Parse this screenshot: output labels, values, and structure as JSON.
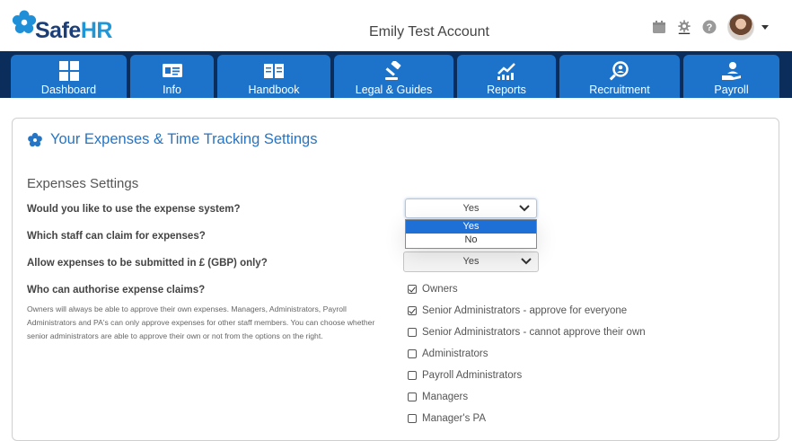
{
  "brand": {
    "name_part1": "Safe",
    "name_part2": "HR",
    "color_dark": "#1c3f78",
    "color_light": "#2196d6"
  },
  "header": {
    "account_name": "Emily Test Account",
    "icons": [
      "calendar-icon",
      "settings-gear-icon",
      "help-icon",
      "user-avatar",
      "account-menu-caret"
    ]
  },
  "nav": {
    "tabs": [
      {
        "label": "Dashboard",
        "icon": "dashboard-grid-icon"
      },
      {
        "label": "Info",
        "icon": "info-card-icon"
      },
      {
        "label": "Handbook",
        "icon": "book-icon"
      },
      {
        "label": "Legal & Guides",
        "icon": "gavel-icon"
      },
      {
        "label": "Reports",
        "icon": "chart-icon"
      },
      {
        "label": "Recruitment",
        "icon": "search-person-icon"
      },
      {
        "label": "Payroll",
        "icon": "hand-user-icon"
      }
    ],
    "bar_color": "#0b2d5c",
    "tab_color": "#1d73c9"
  },
  "page": {
    "title": "Your Expenses & Time Tracking Settings",
    "section_title": "Expenses Settings",
    "questions": {
      "use_system": "Would you like to use the expense system?",
      "which_staff": "Which staff can claim for expenses?",
      "gbp_only": "Allow expenses to be submitted in £ (GBP) only?",
      "who_authorise": "Who can authorise expense claims?"
    },
    "authorise_note": "Owners will always be able to approve their own expenses. Managers, Administrators, Payroll Administrators and PA's can only approve expenses for other staff members. You can choose whether senior administrators are able to approve their own or not from the options on the right.",
    "use_system_select": {
      "value": "Yes",
      "options": [
        "Yes",
        "No"
      ],
      "highlighted": "Yes"
    },
    "gbp_only_select": {
      "value": "Yes"
    },
    "authorisers": [
      {
        "label": "Owners",
        "checked": true
      },
      {
        "label": "Senior Administrators - approve for everyone",
        "checked": true
      },
      {
        "label": "Senior Administrators - cannot approve their own",
        "checked": false
      },
      {
        "label": "Administrators",
        "checked": false
      },
      {
        "label": "Payroll Administrators",
        "checked": false
      },
      {
        "label": "Managers",
        "checked": false
      },
      {
        "label": "Manager's PA",
        "checked": false
      }
    ]
  }
}
